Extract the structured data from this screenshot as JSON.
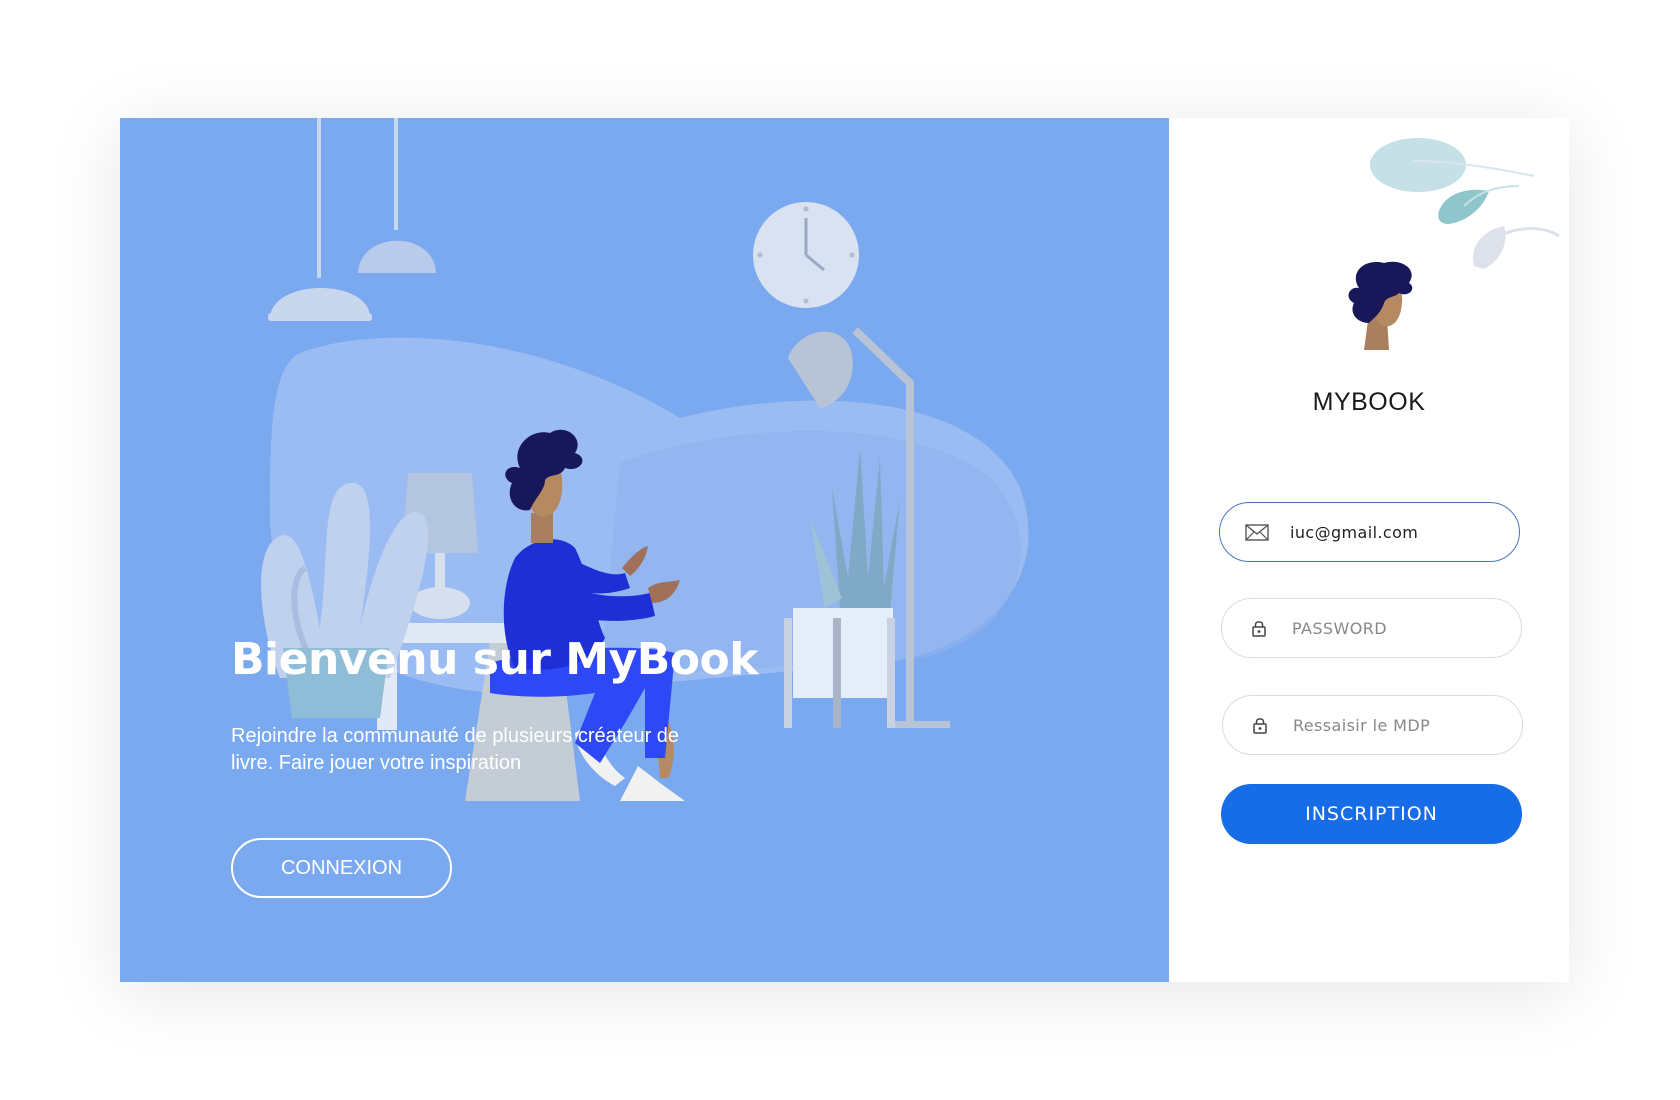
{
  "hero": {
    "title": "Bienvenu sur MyBook",
    "description": "Rejoindre la communauté de plusieurs créateur de livre. Faire jouer votre inspiration",
    "connexion_label": "CONNEXION"
  },
  "brand": {
    "name": "MYBOOK"
  },
  "form": {
    "email": {
      "value": "iuc@gmail.com",
      "icon": "envelope-icon"
    },
    "password": {
      "placeholder": "PASSWORD",
      "icon": "lock-icon"
    },
    "confirm": {
      "placeholder": "Ressaisir le MDP",
      "icon": "lock-icon"
    },
    "submit_label": "INSCRIPTION"
  },
  "colors": {
    "hero_bg": "#7aa9f0",
    "primary": "#176de6",
    "character_shirt": "#1f2fd6"
  }
}
